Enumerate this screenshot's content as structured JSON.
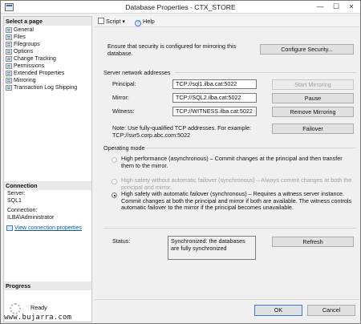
{
  "window": {
    "title": "Database Properties - CTX_STORE",
    "minimize": "—",
    "maximize": "☐",
    "close": "✕"
  },
  "left": {
    "select_page_header": "Select a page",
    "pages": [
      {
        "label": "General",
        "icon": "page-icon"
      },
      {
        "label": "Files",
        "icon": "page-icon"
      },
      {
        "label": "Filegroups",
        "icon": "page-icon"
      },
      {
        "label": "Options",
        "icon": "page-icon"
      },
      {
        "label": "Change Tracking",
        "icon": "page-icon"
      },
      {
        "label": "Permissions",
        "icon": "page-icon"
      },
      {
        "label": "Extended Properties",
        "icon": "page-icon"
      },
      {
        "label": "Mirroring",
        "icon": "page-icon"
      },
      {
        "label": "Transaction Log Shipping",
        "icon": "page-icon"
      }
    ],
    "connection_header": "Connection",
    "server_label": "Server:",
    "server_value": "SQL1",
    "connection_label": "Connection:",
    "connection_value": "ILBA\\Administrator",
    "view_link": "View connection properties",
    "progress_header": "Progress",
    "progress_status": "Ready"
  },
  "toolbar": {
    "script_label": "Script",
    "help_label": "Help",
    "dropdown_glyph": "▾"
  },
  "main": {
    "security_text": "Ensure that security is configured for mirroring this database.",
    "configure_security_button": "Configure Security...",
    "server_network_header": "Server network addresses",
    "principal_label": "Principal:",
    "principal_value": "TCP://sql1.ilba.cat:5022",
    "mirror_label": "Mirror:",
    "mirror_value": "TCP://SQL2.ilba.cat:5022",
    "witness_label": "Witness:",
    "witness_value": "TCP://WITNESS.ilba.cat:5022",
    "start_mirroring_button": "Start Mirroring",
    "pause_button": "Pause",
    "remove_mirroring_button": "Remove Mirroring",
    "failover_button": "Failover",
    "note_line1": "Note: Use fully-qualified TCP addresses. For example:",
    "note_line2": "TCP://svr5.corp.abc.com:5022",
    "operating_mode_header": "Operating mode",
    "mode_high_perf": "High performance (asynchronous) – Commit changes at the principal and then transfer them to the mirror.",
    "mode_high_safety_no_failover": "High safety without automatic failover (synchronous) – Always commit changes at both the principal and mirror.",
    "mode_high_safety_failover": "High safety with automatic failover (synchronous) – Requires a witness server instance. Commit changes at both the principal and mirror if both are available. The witness controls automatic failover to the mirror if the principal becomes unavailable.",
    "status_label": "Status:",
    "status_value": "Synchronized: the databases are fully synchronized",
    "refresh_button": "Refresh"
  },
  "footer": {
    "ok_button": "OK",
    "cancel_button": "Cancel"
  },
  "watermark": "www.bujarra.com"
}
